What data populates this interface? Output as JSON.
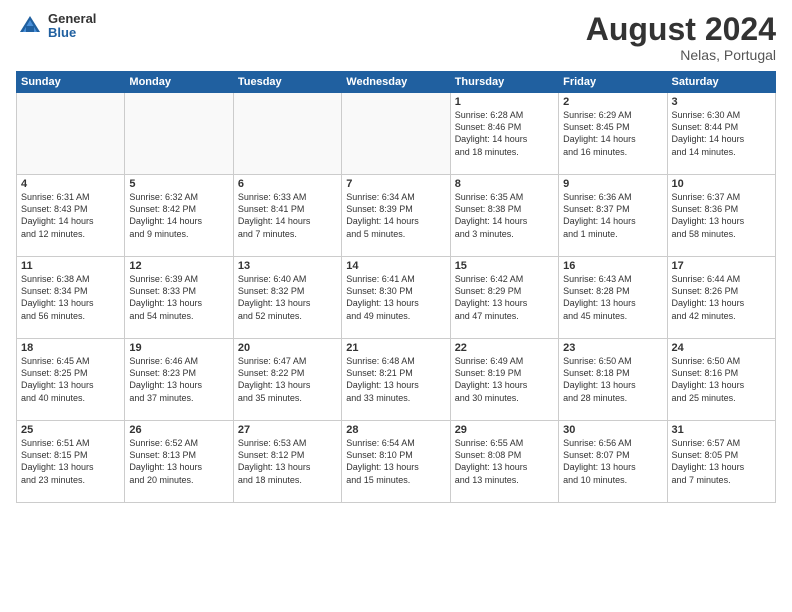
{
  "header": {
    "logo_general": "General",
    "logo_blue": "Blue",
    "month_title": "August 2024",
    "location": "Nelas, Portugal"
  },
  "days_of_week": [
    "Sunday",
    "Monday",
    "Tuesday",
    "Wednesday",
    "Thursday",
    "Friday",
    "Saturday"
  ],
  "weeks": [
    [
      {
        "day": "",
        "info": ""
      },
      {
        "day": "",
        "info": ""
      },
      {
        "day": "",
        "info": ""
      },
      {
        "day": "",
        "info": ""
      },
      {
        "day": "1",
        "info": "Sunrise: 6:28 AM\nSunset: 8:46 PM\nDaylight: 14 hours\nand 18 minutes."
      },
      {
        "day": "2",
        "info": "Sunrise: 6:29 AM\nSunset: 8:45 PM\nDaylight: 14 hours\nand 16 minutes."
      },
      {
        "day": "3",
        "info": "Sunrise: 6:30 AM\nSunset: 8:44 PM\nDaylight: 14 hours\nand 14 minutes."
      }
    ],
    [
      {
        "day": "4",
        "info": "Sunrise: 6:31 AM\nSunset: 8:43 PM\nDaylight: 14 hours\nand 12 minutes."
      },
      {
        "day": "5",
        "info": "Sunrise: 6:32 AM\nSunset: 8:42 PM\nDaylight: 14 hours\nand 9 minutes."
      },
      {
        "day": "6",
        "info": "Sunrise: 6:33 AM\nSunset: 8:41 PM\nDaylight: 14 hours\nand 7 minutes."
      },
      {
        "day": "7",
        "info": "Sunrise: 6:34 AM\nSunset: 8:39 PM\nDaylight: 14 hours\nand 5 minutes."
      },
      {
        "day": "8",
        "info": "Sunrise: 6:35 AM\nSunset: 8:38 PM\nDaylight: 14 hours\nand 3 minutes."
      },
      {
        "day": "9",
        "info": "Sunrise: 6:36 AM\nSunset: 8:37 PM\nDaylight: 14 hours\nand 1 minute."
      },
      {
        "day": "10",
        "info": "Sunrise: 6:37 AM\nSunset: 8:36 PM\nDaylight: 13 hours\nand 58 minutes."
      }
    ],
    [
      {
        "day": "11",
        "info": "Sunrise: 6:38 AM\nSunset: 8:34 PM\nDaylight: 13 hours\nand 56 minutes."
      },
      {
        "day": "12",
        "info": "Sunrise: 6:39 AM\nSunset: 8:33 PM\nDaylight: 13 hours\nand 54 minutes."
      },
      {
        "day": "13",
        "info": "Sunrise: 6:40 AM\nSunset: 8:32 PM\nDaylight: 13 hours\nand 52 minutes."
      },
      {
        "day": "14",
        "info": "Sunrise: 6:41 AM\nSunset: 8:30 PM\nDaylight: 13 hours\nand 49 minutes."
      },
      {
        "day": "15",
        "info": "Sunrise: 6:42 AM\nSunset: 8:29 PM\nDaylight: 13 hours\nand 47 minutes."
      },
      {
        "day": "16",
        "info": "Sunrise: 6:43 AM\nSunset: 8:28 PM\nDaylight: 13 hours\nand 45 minutes."
      },
      {
        "day": "17",
        "info": "Sunrise: 6:44 AM\nSunset: 8:26 PM\nDaylight: 13 hours\nand 42 minutes."
      }
    ],
    [
      {
        "day": "18",
        "info": "Sunrise: 6:45 AM\nSunset: 8:25 PM\nDaylight: 13 hours\nand 40 minutes."
      },
      {
        "day": "19",
        "info": "Sunrise: 6:46 AM\nSunset: 8:23 PM\nDaylight: 13 hours\nand 37 minutes."
      },
      {
        "day": "20",
        "info": "Sunrise: 6:47 AM\nSunset: 8:22 PM\nDaylight: 13 hours\nand 35 minutes."
      },
      {
        "day": "21",
        "info": "Sunrise: 6:48 AM\nSunset: 8:21 PM\nDaylight: 13 hours\nand 33 minutes."
      },
      {
        "day": "22",
        "info": "Sunrise: 6:49 AM\nSunset: 8:19 PM\nDaylight: 13 hours\nand 30 minutes."
      },
      {
        "day": "23",
        "info": "Sunrise: 6:50 AM\nSunset: 8:18 PM\nDaylight: 13 hours\nand 28 minutes."
      },
      {
        "day": "24",
        "info": "Sunrise: 6:50 AM\nSunset: 8:16 PM\nDaylight: 13 hours\nand 25 minutes."
      }
    ],
    [
      {
        "day": "25",
        "info": "Sunrise: 6:51 AM\nSunset: 8:15 PM\nDaylight: 13 hours\nand 23 minutes."
      },
      {
        "day": "26",
        "info": "Sunrise: 6:52 AM\nSunset: 8:13 PM\nDaylight: 13 hours\nand 20 minutes."
      },
      {
        "day": "27",
        "info": "Sunrise: 6:53 AM\nSunset: 8:12 PM\nDaylight: 13 hours\nand 18 minutes."
      },
      {
        "day": "28",
        "info": "Sunrise: 6:54 AM\nSunset: 8:10 PM\nDaylight: 13 hours\nand 15 minutes."
      },
      {
        "day": "29",
        "info": "Sunrise: 6:55 AM\nSunset: 8:08 PM\nDaylight: 13 hours\nand 13 minutes."
      },
      {
        "day": "30",
        "info": "Sunrise: 6:56 AM\nSunset: 8:07 PM\nDaylight: 13 hours\nand 10 minutes."
      },
      {
        "day": "31",
        "info": "Sunrise: 6:57 AM\nSunset: 8:05 PM\nDaylight: 13 hours\nand 7 minutes."
      }
    ]
  ]
}
